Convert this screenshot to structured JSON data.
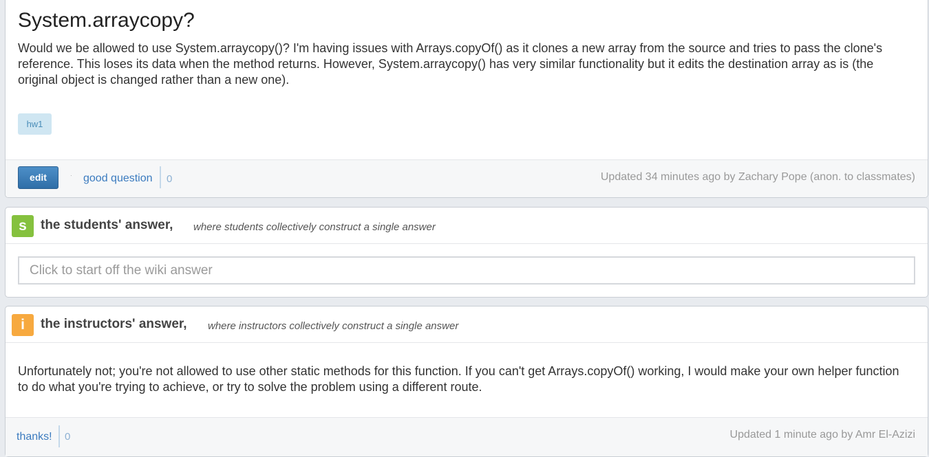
{
  "question": {
    "title": "System.arraycopy?",
    "body": "Would we be allowed to use System.arraycopy()? I'm having issues with Arrays.copyOf() as it clones a new array from the source and tries to pass the clone's reference. This loses its data when the method returns. However, System.arraycopy() has very similar functionality but it edits the destination array as is (the original object is changed rather than a new one).",
    "tag": "hw1",
    "edit_label": "edit",
    "dot": "·",
    "good_question_label": "good question",
    "good_question_count": "0",
    "updated": "Updated 34 minutes ago by Zachary Pope (anon. to classmates)"
  },
  "students_answer": {
    "badge": "s",
    "title": "the students' answer,",
    "subtitle": "where students collectively construct a single answer",
    "placeholder": "Click to start off the wiki answer"
  },
  "instructors_answer": {
    "badge": "i",
    "title": "the instructors' answer,",
    "subtitle": "where instructors collectively construct a single answer",
    "body": "Unfortunately not; you're not allowed to use other static methods for this function. If you can't get Arrays.copyOf() working, I would make your own helper function to do what you're trying to achieve, or try to solve the problem using a different route.",
    "thanks_label": "thanks!",
    "thanks_count": "0",
    "updated": "Updated 1 minute ago by Amr El-Azizi"
  }
}
